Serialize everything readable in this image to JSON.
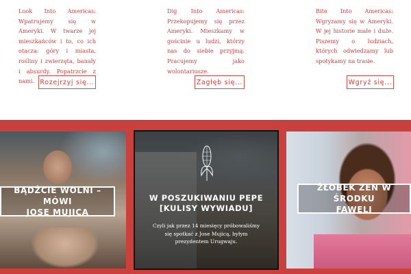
{
  "intro": [
    {
      "text": "Look Into Americas: Wpatrujemy się w Ameryki. W twarze jej mieszkańców i to, co ich otacza: góry i miasta, rośliny i zwierzęta, banały i absurdy. Popatrzcie z nami.",
      "button": "Rozejrzyj się..."
    },
    {
      "text": "Dig Into Americas: Przekopujemy się przez Ameryki. Mieszkamy w gościnie u ludzi, którzy nas do siebie przyjmą. Pracujemy jako wolontariusze.",
      "button": "Zagłęb się..."
    },
    {
      "text": "Bite Into Americas: Wgryzamy się w Ameryki. W jej historie małe i duże. Piszemy o ludziach, których odwiedzamy lub spotykamy na trasie.",
      "button": "Wgryź się..."
    }
  ],
  "cards": [
    {
      "title_line1": "BĄDŹCIE WOLNI – MÓWI",
      "title_line2": "JOSE MUJICA"
    },
    {
      "title_line1": "W POSZUKIWANIU PEPE",
      "title_line2": "[KULISY WYWIADU]",
      "description": "Czyli jak przez 14 miesięcy próbowaliśmy się spotkać z Jose Mujicą, byłym prezydentem Urugwaju."
    },
    {
      "title_line1": "ŻŁOBEK ZEN W ŚRODKU",
      "title_line2": "FAWELI"
    }
  ],
  "colors": {
    "accent": "#c9403d",
    "text_red": "#c8403e"
  }
}
